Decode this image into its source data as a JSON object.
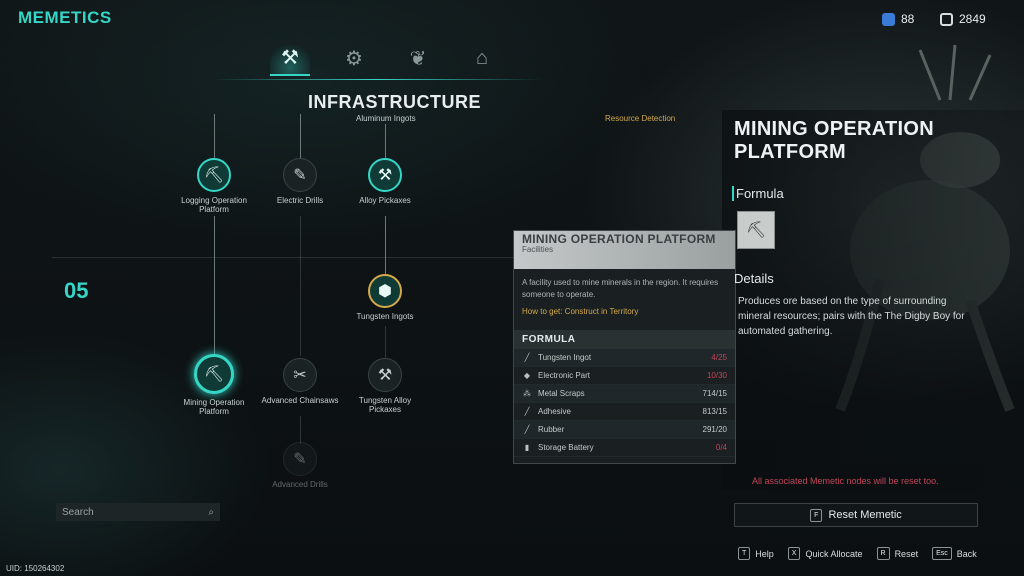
{
  "app": {
    "title": "MEMETICS"
  },
  "currency": [
    {
      "icon": "memetic-point-icon",
      "value": "88",
      "color": "#3a7bd5"
    },
    {
      "icon": "chip-icon",
      "value": "2849",
      "color": "#d8dede"
    }
  ],
  "category_tabs": [
    {
      "name": "infrastructure-tab",
      "icon": "crane-icon",
      "glyph": "⚒",
      "active": true
    },
    {
      "name": "crafting-tab",
      "icon": "workbench-icon",
      "glyph": "⚙",
      "active": false
    },
    {
      "name": "farming-tab",
      "icon": "plant-icon",
      "glyph": "❦",
      "active": false
    },
    {
      "name": "building-tab",
      "icon": "house-icon",
      "glyph": "⌂",
      "active": false
    }
  ],
  "section": {
    "title": "INFRASTRUCTURE",
    "row_number": "05"
  },
  "tree": {
    "top_labels": {
      "aluminum": "Aluminum Ingots",
      "resource_detection": "Resource Detection"
    },
    "nodes": [
      {
        "id": "logging-operation-platform",
        "label": "Logging Operation Platform",
        "state": "unlocked",
        "glyph": "⛏"
      },
      {
        "id": "electric-drills",
        "label": "Electric Drills",
        "state": "locked",
        "glyph": "✎"
      },
      {
        "id": "alloy-pickaxes",
        "label": "Alloy Pickaxes",
        "state": "unlocked",
        "glyph": "⚒"
      },
      {
        "id": "tungsten-ingots",
        "label": "Tungsten Ingots",
        "state": "gold",
        "glyph": "⬢"
      },
      {
        "id": "mining-operation-platform",
        "label": "Mining Operation Platform",
        "state": "selected",
        "glyph": "⛏"
      },
      {
        "id": "advanced-chainsaws",
        "label": "Advanced Chainsaws",
        "state": "locked",
        "glyph": "✂"
      },
      {
        "id": "tungsten-alloy-pickaxes",
        "label": "Tungsten Alloy Pickaxes",
        "state": "locked",
        "glyph": "⚒"
      },
      {
        "id": "advanced-drills",
        "label": "Advanced Drills",
        "state": "locked",
        "glyph": "✎"
      }
    ]
  },
  "search": {
    "placeholder": "Search"
  },
  "uid": "UID: 150264302",
  "tooltip": {
    "title": "MINING OPERATION PLATFORM",
    "category": "Facilities",
    "description": "A facility used to mine minerals in the region. It requires someone to operate.",
    "how_to_get": "How to get: Construct in Territory",
    "formula_heading": "FORMULA",
    "materials": [
      {
        "name": "Tungsten Ingot",
        "qty": "4/25",
        "insufficient": true,
        "glyph": "╱"
      },
      {
        "name": "Electronic Part",
        "qty": "10/30",
        "insufficient": true,
        "glyph": "◆"
      },
      {
        "name": "Metal Scraps",
        "qty": "714/15",
        "insufficient": false,
        "glyph": "⁂"
      },
      {
        "name": "Adhesive",
        "qty": "813/15",
        "insufficient": false,
        "glyph": "╱"
      },
      {
        "name": "Rubber",
        "qty": "291/20",
        "insufficient": false,
        "glyph": "╱"
      },
      {
        "name": "Storage Battery",
        "qty": "0/4",
        "insufficient": true,
        "glyph": "▮"
      }
    ]
  },
  "detail": {
    "title": "MINING OPERATION PLATFORM",
    "formula_label": "Formula",
    "details_label": "Details",
    "description": "Produces ore based on the type of surrounding mineral resources; pairs with the The Digby Boy for automated gathering.",
    "reset_warning": "All associated Memetic nodes will be reset too.",
    "reset_key": "F",
    "reset_label": "Reset Memetic"
  },
  "hints": [
    {
      "key": "T",
      "label": "Help"
    },
    {
      "key": "X",
      "label": "Quick Allocate"
    },
    {
      "key": "R",
      "label": "Reset"
    },
    {
      "key": "Esc",
      "label": "Back"
    }
  ],
  "colors": {
    "accent": "#35d6c6",
    "warning": "#c2455a",
    "gold": "#d4a94a"
  }
}
